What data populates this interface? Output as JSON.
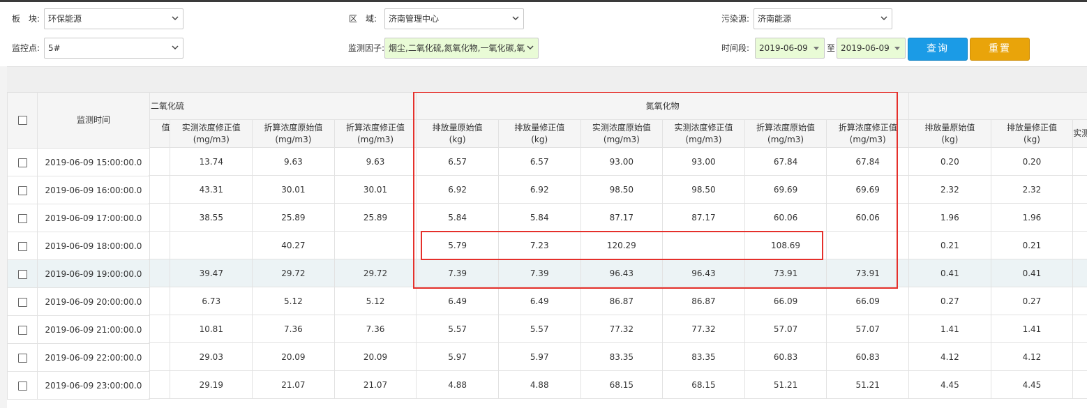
{
  "filters": {
    "sector_label": "板　块:",
    "sector_value": "环保能源",
    "region_label": "区　域:",
    "region_value": "济南管理中心",
    "source_label": "污染源:",
    "source_value": "济南能源",
    "point_label": "监控点:",
    "point_value": "5#",
    "factor_label": "监测因子:",
    "factor_value": "烟尘,二氧化硫,氮氧化物,一氧化碳,氧",
    "time_label": "时间段:",
    "date_from": "2019-06-09",
    "date_sep": "至",
    "date_to": "2019-06-09",
    "query_button": "查询",
    "reset_button": "重置",
    "accent_blue": "#1b9be6",
    "accent_orange": "#e9a40a"
  },
  "table": {
    "time_header": "监测时间",
    "group_so2": "二氧化硫",
    "group_nox": "氮氧化物",
    "partial_left_header": "值",
    "sub_headers_so2": [
      {
        "name": "实测浓度修正值",
        "unit": "(mg/m3)"
      },
      {
        "name": "折算浓度原始值",
        "unit": "(mg/m3)"
      },
      {
        "name": "折算浓度修正值",
        "unit": "(mg/m3)"
      }
    ],
    "sub_headers_nox": [
      {
        "name": "排放量原始值",
        "unit": "(kg)"
      },
      {
        "name": "排放量修正值",
        "unit": "(kg)"
      },
      {
        "name": "实测浓度原始值",
        "unit": "(mg/m3)"
      },
      {
        "name": "实测浓度修正值",
        "unit": "(mg/m3)"
      },
      {
        "name": "折算浓度原始值",
        "unit": "(mg/m3)"
      },
      {
        "name": "折算浓度修正值",
        "unit": "(mg/m3)"
      }
    ],
    "sub_headers_next": [
      {
        "name": "排放量原始值",
        "unit": "(kg)"
      },
      {
        "name": "排放量修正值",
        "unit": "(kg)"
      },
      {
        "name": "实测",
        "unit": ""
      }
    ],
    "rows": [
      {
        "time": "2019-06-09 15:00:00.0",
        "so2": [
          "13.74",
          "9.63",
          "9.63"
        ],
        "nox": [
          "6.57",
          "6.57",
          "93.00",
          "93.00",
          "67.84",
          "67.84"
        ],
        "next": [
          "0.20",
          "0.20"
        ]
      },
      {
        "time": "2019-06-09 16:00:00.0",
        "so2": [
          "43.31",
          "30.01",
          "30.01"
        ],
        "nox": [
          "6.92",
          "6.92",
          "98.50",
          "98.50",
          "69.69",
          "69.69"
        ],
        "next": [
          "2.32",
          "2.32"
        ]
      },
      {
        "time": "2019-06-09 17:00:00.0",
        "so2": [
          "38.55",
          "25.89",
          "25.89"
        ],
        "nox": [
          "5.84",
          "5.84",
          "87.17",
          "87.17",
          "60.06",
          "60.06"
        ],
        "next": [
          "1.96",
          "1.96"
        ]
      },
      {
        "time": "2019-06-09 18:00:00.0",
        "so2": [
          "",
          "40.27",
          ""
        ],
        "nox": [
          "5.79",
          "7.23",
          "120.29",
          "",
          "108.69",
          ""
        ],
        "next": [
          "0.21",
          "0.21"
        ]
      },
      {
        "time": "2019-06-09 19:00:00.0",
        "so2": [
          "39.47",
          "29.72",
          "29.72"
        ],
        "nox": [
          "7.39",
          "7.39",
          "96.43",
          "96.43",
          "73.91",
          "73.91"
        ],
        "next": [
          "0.41",
          "0.41"
        ],
        "highlighted": true
      },
      {
        "time": "2019-06-09 20:00:00.0",
        "so2": [
          "6.73",
          "5.12",
          "5.12"
        ],
        "nox": [
          "6.49",
          "6.49",
          "86.87",
          "86.87",
          "66.09",
          "66.09"
        ],
        "next": [
          "0.27",
          "0.27"
        ]
      },
      {
        "time": "2019-06-09 21:00:00.0",
        "so2": [
          "10.81",
          "7.36",
          "7.36"
        ],
        "nox": [
          "5.57",
          "5.57",
          "77.32",
          "77.32",
          "57.07",
          "57.07"
        ],
        "next": [
          "1.41",
          "1.41"
        ]
      },
      {
        "time": "2019-06-09 22:00:00.0",
        "so2": [
          "29.03",
          "20.09",
          "20.09"
        ],
        "nox": [
          "5.97",
          "5.97",
          "83.35",
          "83.35",
          "60.83",
          "60.83"
        ],
        "next": [
          "4.12",
          "4.12"
        ]
      },
      {
        "time": "2019-06-09 23:00:00.0",
        "so2": [
          "29.19",
          "21.07",
          "21.07"
        ],
        "nox": [
          "4.88",
          "4.88",
          "68.15",
          "68.15",
          "51.21",
          "51.21"
        ],
        "next": [
          "4.45",
          "4.45"
        ]
      }
    ],
    "highlight_color": "#ecf3f5",
    "annotation_color": "#e5302b"
  }
}
